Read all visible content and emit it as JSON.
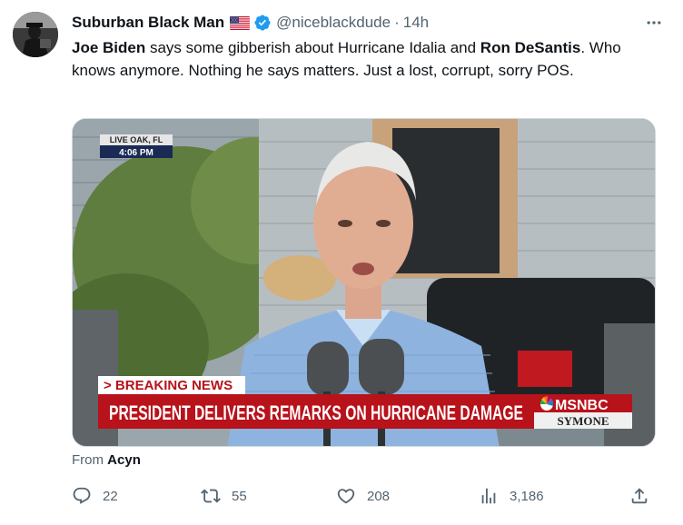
{
  "tweet": {
    "author_name": "Suburban Black Man",
    "handle": "@niceblackdude",
    "separator": "·",
    "time": "14h",
    "text_parts": [
      {
        "text": "Joe Biden",
        "bold": true
      },
      {
        "text": " says some gibberish about Hurricane Idalia and ",
        "bold": false
      },
      {
        "text": "Ron DeSantis",
        "bold": true
      },
      {
        "text": ". Who knows anymore. Nothing he says matters. Just a lost, corrupt, sorry POS.",
        "bold": false
      }
    ],
    "from_label": "From",
    "from_source": "Acyn"
  },
  "media": {
    "location": "LIVE OAK, FL",
    "clock": "4:06 PM",
    "breaking_tag": "> BREAKING NEWS",
    "headline": "PRESIDENT DELIVERS REMARKS ON HURRICANE DAMAGE",
    "network": "MSNBC",
    "show": "SYMONE"
  },
  "actions": {
    "replies": "22",
    "retweets": "55",
    "likes": "208",
    "views": "3,186"
  },
  "colors": {
    "text_primary": "#0f1419",
    "text_secondary": "#536471",
    "verified_blue": "#1d9bf0",
    "breaking_red": "#b8121b"
  },
  "icons": [
    "avatar",
    "us-flag-icon",
    "verified-badge-icon",
    "more-icon",
    "reply-icon",
    "retweet-icon",
    "like-icon",
    "views-icon",
    "share-icon"
  ]
}
